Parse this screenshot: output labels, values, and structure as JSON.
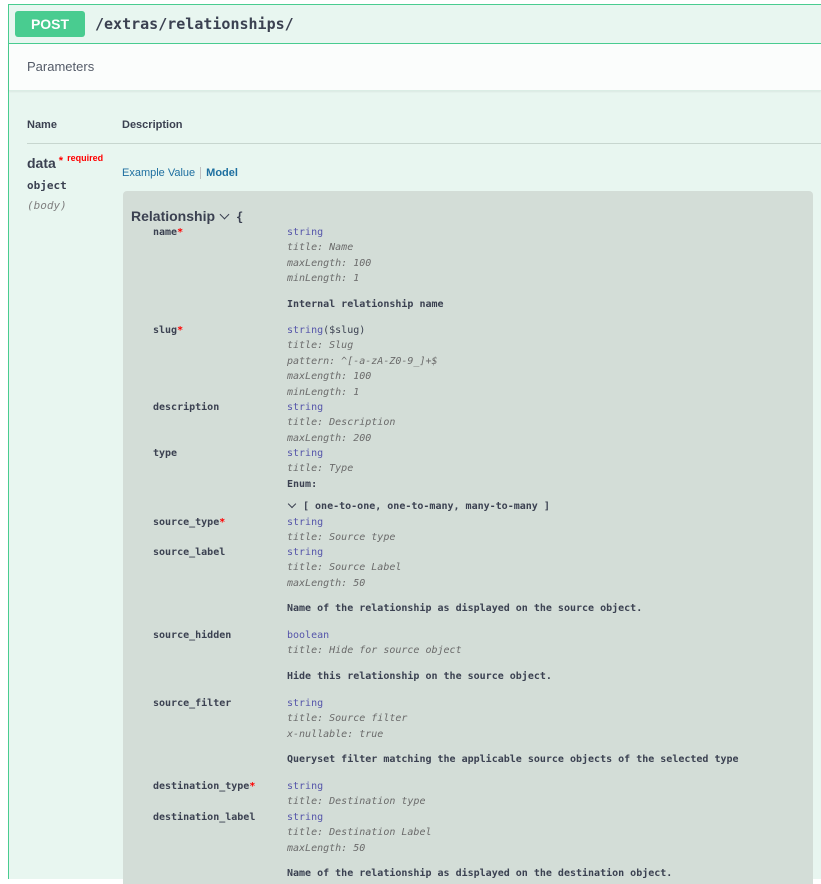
{
  "operation": {
    "method": "POST",
    "path": "/extras/relationships/"
  },
  "parameters_section": {
    "title": "Parameters"
  },
  "table": {
    "col_name": "Name",
    "col_description": "Description"
  },
  "param": {
    "name": "data",
    "required_star": "*",
    "required_label": "required",
    "type": "object",
    "in": "(body)"
  },
  "tabs": {
    "example": "Example Value",
    "model": "Model"
  },
  "model": {
    "title": "Relationship",
    "open_brace": "{",
    "rows": [
      {
        "name": "name",
        "required": true,
        "lines": [
          {
            "text": "string",
            "kind": "type"
          },
          {
            "text": "title: Name",
            "kind": "prop"
          },
          {
            "text": "maxLength: 100",
            "kind": "prop"
          },
          {
            "text": "minLength: 1",
            "kind": "prop"
          },
          {
            "text": "Internal relationship name",
            "kind": "desc"
          }
        ]
      },
      {
        "name": "slug",
        "required": true,
        "lines": [
          {
            "text": "string",
            "kind": "type",
            "suffix": "($slug)"
          },
          {
            "text": "title: Slug",
            "kind": "prop"
          },
          {
            "text": "pattern: ^[-a-zA-Z0-9_]+$",
            "kind": "prop"
          },
          {
            "text": "maxLength: 100",
            "kind": "prop"
          },
          {
            "text": "minLength: 1",
            "kind": "prop"
          }
        ]
      },
      {
        "name": "description",
        "required": false,
        "lines": [
          {
            "text": "string",
            "kind": "type"
          },
          {
            "text": "title: Description",
            "kind": "prop"
          },
          {
            "text": "maxLength: 200",
            "kind": "prop"
          }
        ]
      },
      {
        "name": "type",
        "required": false,
        "lines": [
          {
            "text": "string",
            "kind": "type"
          },
          {
            "text": "title: Type",
            "kind": "prop"
          },
          {
            "text": "Enum:",
            "kind": "desc"
          },
          {
            "text": "[ one-to-one, one-to-many, many-to-many ]",
            "kind": "enum"
          }
        ]
      },
      {
        "name": "source_type",
        "required": true,
        "lines": [
          {
            "text": "string",
            "kind": "type"
          },
          {
            "text": "title: Source type",
            "kind": "prop"
          }
        ]
      },
      {
        "name": "source_label",
        "required": false,
        "lines": [
          {
            "text": "string",
            "kind": "type"
          },
          {
            "text": "title: Source Label",
            "kind": "prop"
          },
          {
            "text": "maxLength: 50",
            "kind": "prop"
          },
          {
            "text": "Name of the relationship as displayed on the source object.",
            "kind": "desc"
          }
        ]
      },
      {
        "name": "source_hidden",
        "required": false,
        "lines": [
          {
            "text": "boolean",
            "kind": "type"
          },
          {
            "text": "title: Hide for source object",
            "kind": "prop"
          },
          {
            "text": "Hide this relationship on the source object.",
            "kind": "desc"
          }
        ]
      },
      {
        "name": "source_filter",
        "required": false,
        "lines": [
          {
            "text": "string",
            "kind": "type"
          },
          {
            "text": "title: Source filter",
            "kind": "prop"
          },
          {
            "text": "x-nullable: true",
            "kind": "prop"
          },
          {
            "text": "Queryset filter matching the applicable source objects of the selected type",
            "kind": "desc"
          }
        ]
      },
      {
        "name": "destination_type",
        "required": true,
        "lines": [
          {
            "text": "string",
            "kind": "type"
          },
          {
            "text": "title: Destination type",
            "kind": "prop"
          }
        ]
      },
      {
        "name": "destination_label",
        "required": false,
        "lines": [
          {
            "text": "string",
            "kind": "type"
          },
          {
            "text": "title: Destination Label",
            "kind": "prop"
          },
          {
            "text": "maxLength: 50",
            "kind": "prop"
          },
          {
            "text": "Name of the relationship as displayed on the destination object.",
            "kind": "desc"
          }
        ]
      }
    ]
  }
}
